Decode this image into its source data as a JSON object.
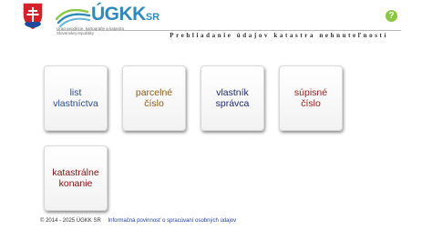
{
  "header": {
    "logo_text": "ÚGKK",
    "logo_suffix": "SR",
    "logo_subline1": "Úrad geodézie, kartografie a katastra",
    "logo_subline2": "Slovenskej republiky",
    "help_symbol": "?",
    "page_title": "Prehliadanie údajov katastra nehnuteľností",
    "icons": {
      "coat_of_arms": "slovak-coat-of-arms-icon",
      "logo": "ugkk-logo-icon",
      "help": "help-icon"
    }
  },
  "tiles": [
    {
      "id": "list-vlastnictva",
      "label_line1": "list",
      "label_line2": "vlastníctva",
      "color": "#2b4d87"
    },
    {
      "id": "parcelne-cislo",
      "label_line1": "parcelné",
      "label_line2": "číslo",
      "color": "#8a5a17"
    },
    {
      "id": "vlastnik-spravca",
      "label_line1": "vlastník",
      "label_line2": "správca",
      "color": "#1f2a6b"
    },
    {
      "id": "supisne-cislo",
      "label_line1": "súpisné",
      "label_line2": "číslo",
      "color": "#8b1c1c"
    },
    {
      "id": "katastralne-konanie",
      "label_line1": "katastrálne",
      "label_line2": "konanie",
      "color": "#7a1010"
    }
  ],
  "footer": {
    "copyright": "© 2014 - 2025 ÚGKK SR",
    "link": "Informačná povinnosť o spracúvaní osobných údajov"
  },
  "colors": {
    "brand_blue": "#2f8ab9",
    "help_green": "#8dc63f"
  }
}
